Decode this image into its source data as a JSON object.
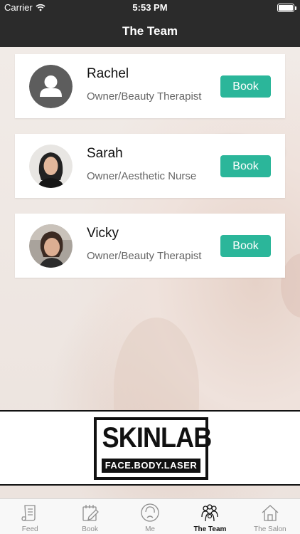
{
  "status_bar": {
    "carrier": "Carrier",
    "time": "5:53 PM"
  },
  "nav": {
    "title": "The Team"
  },
  "team": [
    {
      "name": "Rachel",
      "role": "Owner/Beauty Therapist",
      "book_label": "Book"
    },
    {
      "name": "Sarah",
      "role": "Owner/Aesthetic Nurse",
      "book_label": "Book"
    },
    {
      "name": "Vicky",
      "role": "Owner/Beauty Therapist",
      "book_label": "Book"
    }
  ],
  "logo": {
    "name": "SKINLAB",
    "tagline": "FACE.BODY.LASER"
  },
  "tabs": [
    {
      "label": "Feed",
      "icon": "feed-icon"
    },
    {
      "label": "Book",
      "icon": "book-icon"
    },
    {
      "label": "Me",
      "icon": "me-icon"
    },
    {
      "label": "The Team",
      "icon": "team-icon",
      "active": true
    },
    {
      "label": "The Salon",
      "icon": "salon-icon"
    }
  ],
  "colors": {
    "accent": "#2bb69a",
    "bar": "#2b2b2b"
  }
}
